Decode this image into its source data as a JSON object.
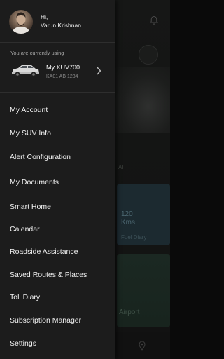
{
  "profile": {
    "greeting": "Hi,",
    "name": "Varun Krishnan"
  },
  "vehicle": {
    "using_label": "You are currently using",
    "name": "My XUV700",
    "plate": "KA01 AB 1234"
  },
  "menu": {
    "items": [
      {
        "label": "My Account"
      },
      {
        "label": "My SUV Info"
      },
      {
        "label": "Alert Configuration"
      },
      {
        "label": "My Documents"
      },
      {
        "label": "Smart Home"
      },
      {
        "label": "Calendar"
      },
      {
        "label": "Roadside Assistance"
      },
      {
        "label": "Saved Routes & Places"
      },
      {
        "label": "Toll Diary"
      },
      {
        "label": "Subscription Manager"
      },
      {
        "label": "Settings"
      }
    ]
  },
  "background": {
    "tile_value": "120",
    "tile_unit": "Kms",
    "tile_sub": "Fuel Diary",
    "card_label": "Airport",
    "section_label": "AI"
  },
  "colors": {
    "drawer_bg": "#1c1c1c",
    "text_primary": "#f2f2f2",
    "text_secondary": "#a8a8a8"
  }
}
